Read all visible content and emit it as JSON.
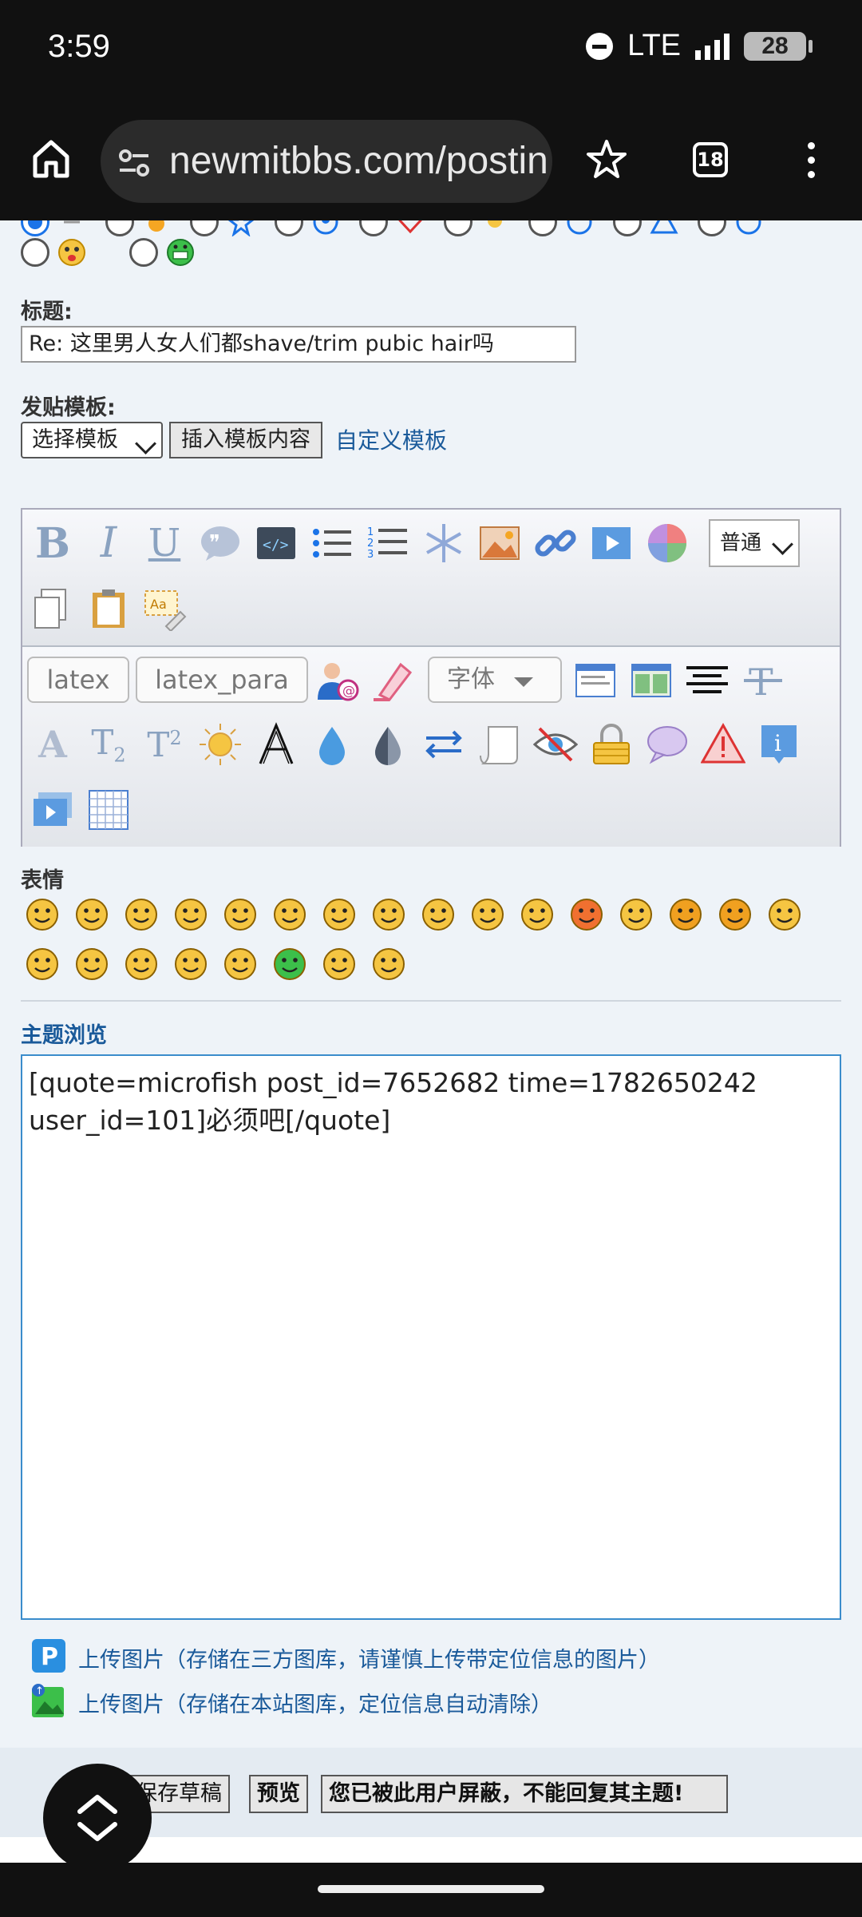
{
  "status": {
    "time": "3:59",
    "network": "LTE",
    "battery": "28"
  },
  "browser": {
    "url": "newmitbbs.com/postin",
    "tab_count": "18"
  },
  "form": {
    "title_label": "标题:",
    "title_value": "Re: 这里男人女人们都shave/trim pubic hair吗",
    "template_label": "发贴模板:",
    "template_select": "选择模板",
    "insert_template_button": "插入模板内容",
    "custom_template_link": "自定义模板",
    "format_select": "普通",
    "latex_button": "latex",
    "latex_para_button": "latex_para",
    "font_select": "字体",
    "emoticons_label": "表情",
    "topic_preview_label": "主题浏览",
    "content": "[quote=microfish post_id=7652682 time=1782650242\nuser_id=101]必须吧[/quote]",
    "upload_third_party": "上传图片（存储在三方图库，请谨慎上传带定位信息的图片）",
    "upload_local": "上传图片（存储在本站图库，定位信息自动清除）"
  },
  "footer": {
    "save_draft_button": "保存草稿",
    "preview_button": "预览",
    "blocked_button": "您已被此用户屏蔽，不能回复其主题!"
  },
  "colors": {
    "link": "#1a5a9a",
    "accent": "#1a73e8",
    "textarea_border": "#3a8ccc"
  }
}
